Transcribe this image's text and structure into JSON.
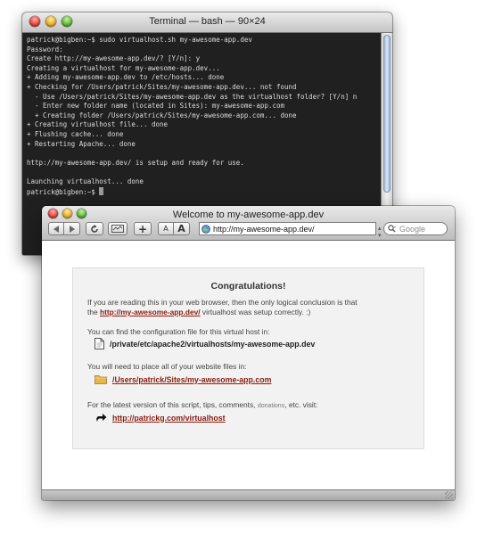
{
  "terminal": {
    "title": "Terminal — bash — 90×24",
    "lines": [
      "patrick@bigben:~$ sudo virtualhost.sh my-awesome-app.dev",
      "Password:",
      "Create http://my-awesome-app.dev/? [Y/n]: y",
      "Creating a virtualhost for my-awesome-app.dev...",
      "+ Adding my-awesome-app.dev to /etc/hosts... done",
      "+ Checking for /Users/patrick/Sites/my-awesome-app.dev... not found",
      "  - Use /Users/patrick/Sites/my-awesome-app.dev as the virtualhost folder? [Y/n] n",
      "  - Enter new folder name (located in Sites): my-awesome-app.com",
      "  + Creating folder /Users/patrick/Sites/my-awesome-app.com... done",
      "+ Creating virtualhost file... done",
      "+ Flushing cache... done",
      "+ Restarting Apache... done",
      "",
      "http://my-awesome-app.dev/ is setup and ready for use.",
      "",
      "Launching virtualhost... done"
    ],
    "prompt": "patrick@bigben:~$ "
  },
  "browser": {
    "title": "Welcome to my-awesome-app.dev",
    "url": "http://my-awesome-app.dev/",
    "search_placeholder": "Google",
    "font_small": "A",
    "font_large": "A",
    "add_label": "+"
  },
  "page": {
    "heading": "Congratulations!",
    "intro_before": "If you are reading this in your web browser, then the only logical conclusion is that",
    "intro_the": "the ",
    "intro_link": "http://my-awesome-app.dev/",
    "intro_after": " virtualhost was setup correctly. :)",
    "config_text": "You can find the configuration file for this virtual host in:",
    "config_path": "/private/etc/apache2/virtualhosts/my-awesome-app.dev",
    "files_text": "You will need to place all of your website files in:",
    "files_path": "/Users/patrick/Sites/my-awesome-app.com",
    "latest_before": "For the latest version of this script, tips, comments, ",
    "latest_donations": "donations",
    "latest_after": ", etc. visit:",
    "latest_link": "http://patrickg.com/virtualhost"
  }
}
